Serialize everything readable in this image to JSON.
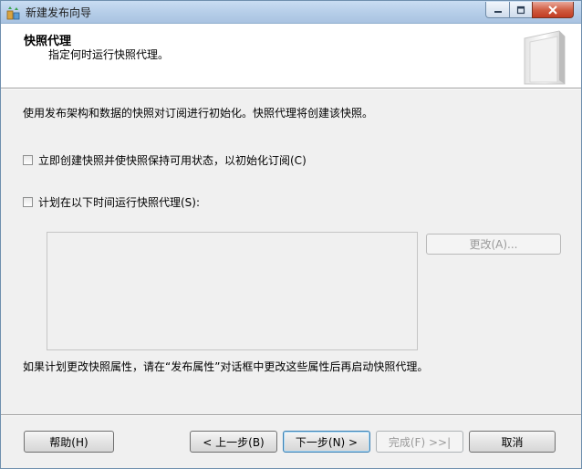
{
  "window": {
    "title": "新建发布向导"
  },
  "header": {
    "title": "快照代理",
    "subtitle": "指定何时运行快照代理。"
  },
  "main": {
    "description": "使用发布架构和数据的快照对订阅进行初始化。快照代理将创建该快照。",
    "option_immediate": {
      "label": "立即创建快照并使快照保持可用状态，以初始化订阅(C)",
      "checked": false
    },
    "option_schedule": {
      "label": "计划在以下时间运行快照代理(S):",
      "checked": false
    },
    "schedule_text": "",
    "change_button": "更改(A)...",
    "note": "如果计划更改快照属性，请在“发布属性”对话框中更改这些属性后再启动快照代理。"
  },
  "footer": {
    "help": "帮助(H)",
    "back": "< 上一步(B)",
    "next": "下一步(N) >",
    "finish": "完成(F) >>|",
    "cancel": "取消"
  }
}
